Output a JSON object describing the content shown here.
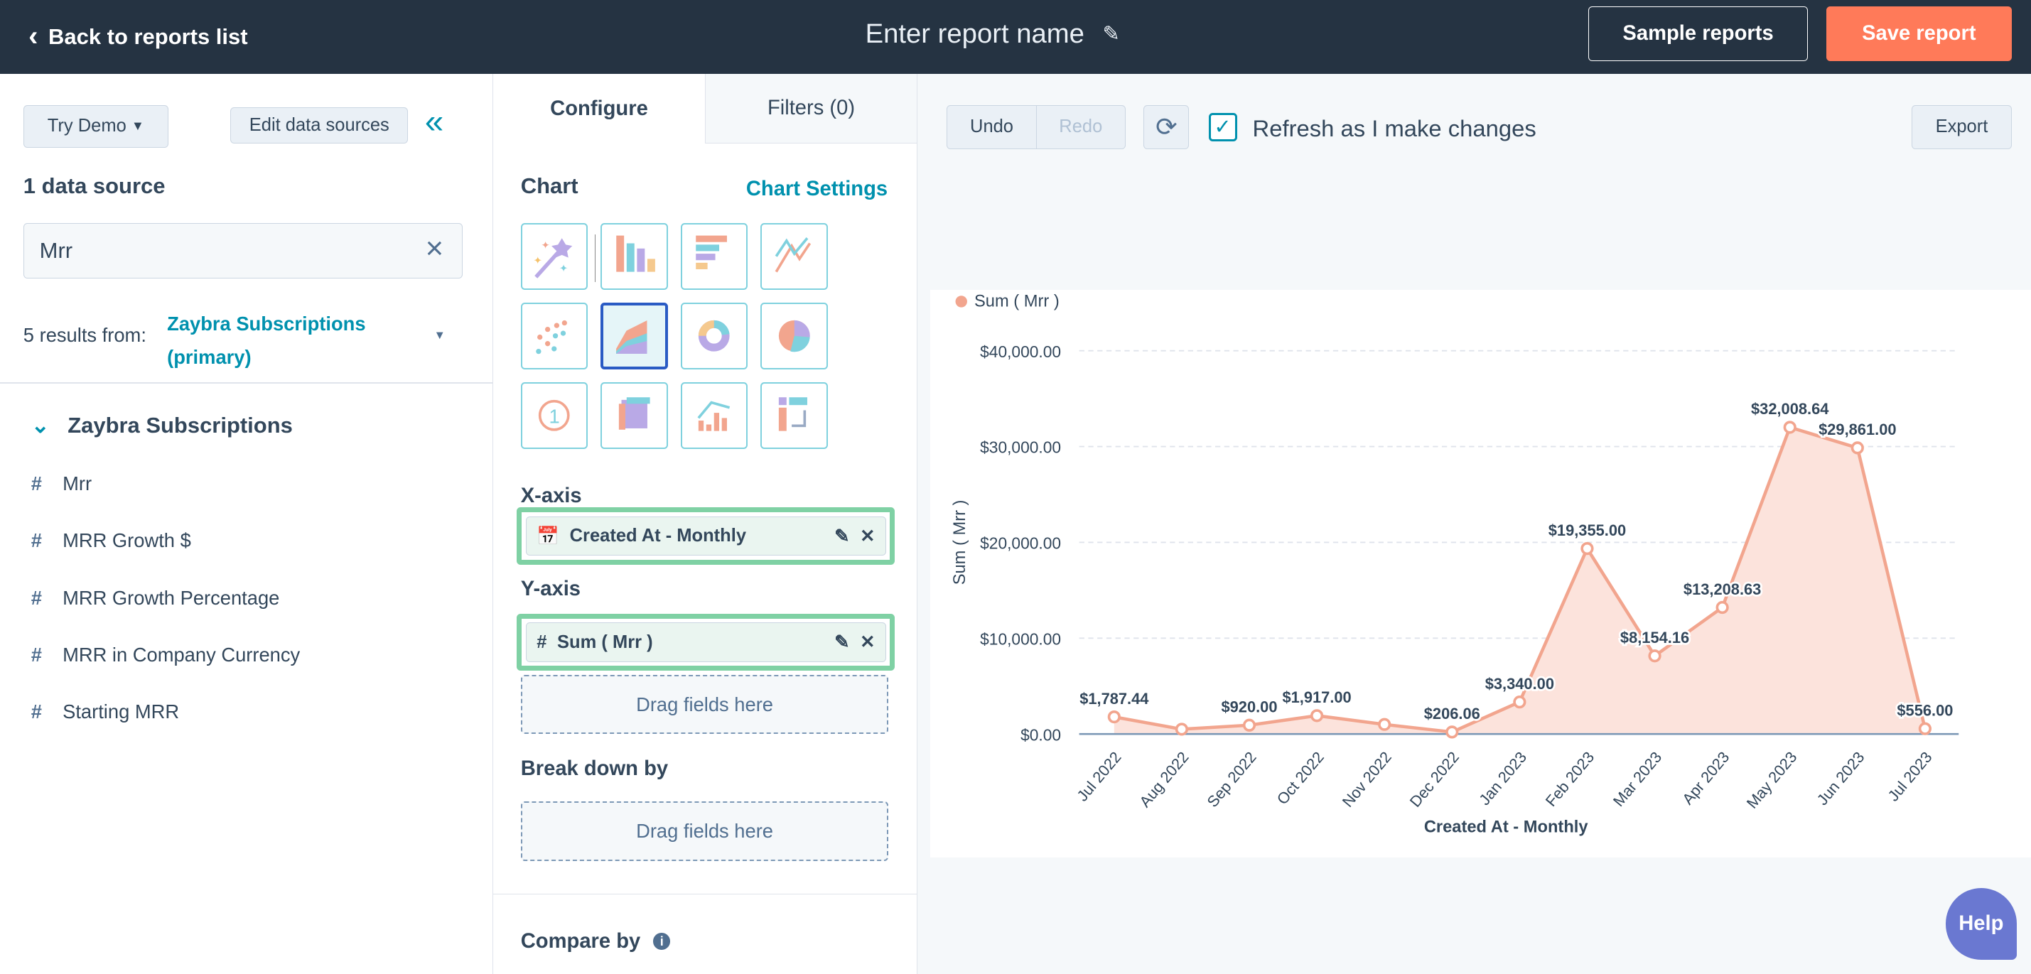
{
  "topbar": {
    "back_label": "Back to reports list",
    "report_name_placeholder": "Enter report name",
    "sample_reports": "Sample reports",
    "save_report": "Save report"
  },
  "left": {
    "try_demo": "Try Demo",
    "edit_sources": "Edit data sources",
    "data_source_count": "1 data source",
    "search_value": "Mrr",
    "results_prefix": "5 results from:",
    "results_source_line1": "Zaybra Subscriptions",
    "results_source_line2": "(primary)",
    "group_title": "Zaybra Subscriptions",
    "fields": [
      "Mrr",
      "MRR Growth $",
      "MRR Growth Percentage",
      "MRR in Company Currency",
      "Starting MRR"
    ]
  },
  "config": {
    "tab_configure": "Configure",
    "tab_filters": "Filters (0)",
    "chart_heading": "Chart",
    "chart_settings": "Chart Settings",
    "chart_types": [
      "magic-wand",
      "vertical-bar",
      "horizontal-bar",
      "line",
      "scatter",
      "area",
      "donut",
      "pie",
      "summary",
      "pivot-table",
      "combination",
      "table"
    ],
    "selected_chart_type": "area",
    "xaxis_label": "X-axis",
    "xaxis_field": "Created At - Monthly",
    "yaxis_label": "Y-axis",
    "yaxis_field": "Sum ( Mrr )",
    "drag_placeholder": "Drag fields here",
    "breakdown_label": "Break down by",
    "compare_label": "Compare by"
  },
  "toolbar": {
    "undo": "Undo",
    "redo": "Redo",
    "refresh_label": "Refresh as I make changes",
    "refresh_checked": true,
    "export": "Export"
  },
  "help": "Help",
  "colors": {
    "topbar": "#253342",
    "accent_orange": "#ff7a59",
    "teal": "#0091ae",
    "series": "#f2a58e",
    "area_fill": "#fce3dc",
    "pill_border": "#7fd1a4"
  },
  "chart_data": {
    "type": "area",
    "legend": "Sum ( Mrr )",
    "legend_position": "top-left",
    "xlabel": "Created At - Monthly",
    "ylabel": "Sum ( Mrr )",
    "ylim": [
      0,
      40000
    ],
    "yticks": [
      "$0.00",
      "$10,000.00",
      "$20,000.00",
      "$30,000.00",
      "$40,000.00"
    ],
    "grid": true,
    "categories": [
      "Jul 2022",
      "Aug 2022",
      "Sep 2022",
      "Oct 2022",
      "Nov 2022",
      "Dec 2022",
      "Jan 2023",
      "Feb 2023",
      "Mar 2023",
      "Apr 2023",
      "May 2023",
      "Jun 2023",
      "Jul 2023"
    ],
    "values": [
      1787.44,
      500,
      920,
      1917,
      1000,
      206.06,
      3340,
      19355,
      8154.16,
      13208.63,
      32008.64,
      29861,
      556
    ],
    "labels": [
      "$1,787.44",
      "",
      "$920.00",
      "$1,917.00",
      "",
      "$206.06",
      "$3,340.00",
      "$19,355.00",
      "$8,154.16",
      "$13,208.63",
      "$32,008.64",
      "$29,861.00",
      "$556.00"
    ]
  }
}
